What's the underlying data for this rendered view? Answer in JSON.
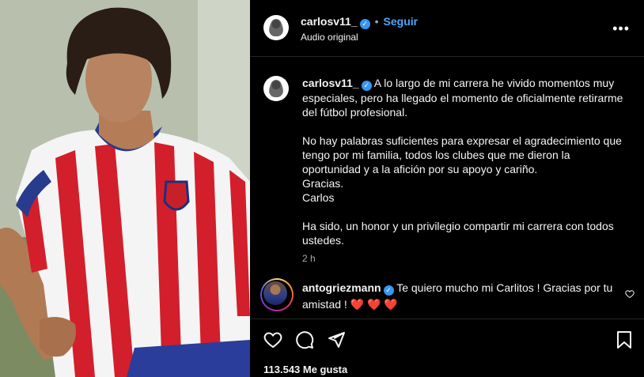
{
  "post": {
    "username": "carlosv11_",
    "follow_label": "Seguir",
    "dot": "•",
    "audio_label": "Audio original",
    "more_label": "•••"
  },
  "caption": {
    "username": "carlosv11_",
    "line1": "A lo largo de mi carrera he vivido momentos muy especiales, pero ha llegado el momento de oficialmente retirarme del fútbol profesional.",
    "line2": "No hay palabras suficientes para expresar el agradecimiento que tengo por mi familia, todos los clubes que me dieron la oportunidad y a la afición por su apoyo y cariño.",
    "line3": "Gracias.",
    "line4": "Carlos",
    "line5": "Ha sido, un honor y un privilegio compartir mi carrera con todos ustedes.",
    "time": "2 h"
  },
  "comment": {
    "username": "antogriezmann",
    "text": "Te quiero mucho mi Carlitos ! Gracias por tu amistad !",
    "hearts": "❤️ ❤️ ❤️"
  },
  "stats": {
    "likes": "113.543 Me gusta"
  },
  "icons": [
    "verified-icon",
    "more-icon",
    "heart-icon",
    "comment-icon",
    "share-icon",
    "save-icon"
  ],
  "colors": {
    "accent": "#4ca6ff",
    "verified": "#3897f0",
    "heart": "#ff3040",
    "background": "#000000"
  }
}
